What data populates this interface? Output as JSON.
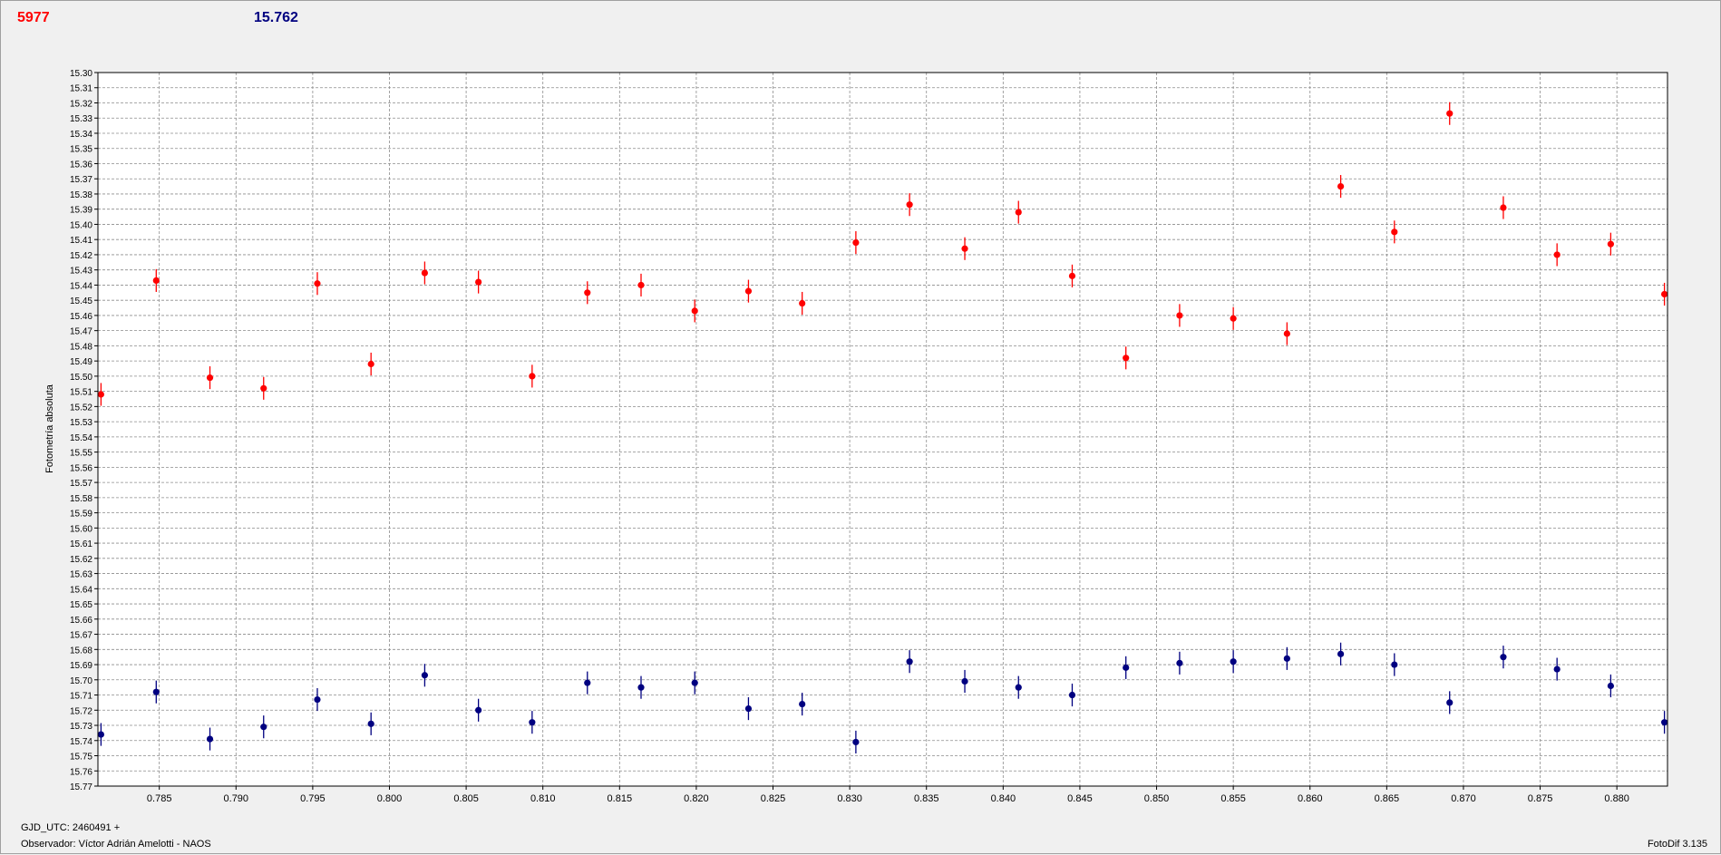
{
  "header": {
    "left_value": "5977",
    "right_value": "15.762",
    "left_color": "#ff0000",
    "right_color": "#000080"
  },
  "footer": {
    "gjd": "GJD_UTC: 2460491 +",
    "observer": "Observador: Víctor Adrián Amelotti - NAOS",
    "software": "FotoDif 3.135"
  },
  "chart_data": {
    "type": "scatter",
    "title": "",
    "xlabel": "",
    "ylabel": "Fotometría absoluta",
    "xlim": [
      0.781,
      0.8833
    ],
    "ylim": [
      15.3,
      15.77
    ],
    "y_inverted": true,
    "grid": true,
    "x_ticks": [
      "0.785",
      "0.790",
      "0.795",
      "0.800",
      "0.805",
      "0.810",
      "0.815",
      "0.820",
      "0.825",
      "0.830",
      "0.835",
      "0.840",
      "0.845",
      "0.850",
      "0.855",
      "0.860",
      "0.865",
      "0.870",
      "0.875",
      "0.880"
    ],
    "y_ticks": [
      "15.30",
      "15.31",
      "15.32",
      "15.33",
      "15.34",
      "15.35",
      "15.36",
      "15.37",
      "15.38",
      "15.39",
      "15.40",
      "15.41",
      "15.42",
      "15.43",
      "15.44",
      "15.45",
      "15.46",
      "15.47",
      "15.48",
      "15.49",
      "15.50",
      "15.51",
      "15.52",
      "15.53",
      "15.54",
      "15.55",
      "15.56",
      "15.57",
      "15.58",
      "15.59",
      "15.60",
      "15.61",
      "15.62",
      "15.63",
      "15.64",
      "15.65",
      "15.66",
      "15.67",
      "15.68",
      "15.69",
      "15.70",
      "15.71",
      "15.72",
      "15.73",
      "15.74",
      "15.75",
      "15.76",
      "15.77"
    ],
    "series": [
      {
        "color": "#ff0000",
        "x": [
          0.7812,
          0.7848,
          0.7883,
          0.7918,
          0.7953,
          0.7988,
          0.8023,
          0.8058,
          0.8093,
          0.8129,
          0.8164,
          0.8199,
          0.8234,
          0.8269,
          0.8304,
          0.8339,
          0.8375,
          0.841,
          0.8445,
          0.848,
          0.8515,
          0.855,
          0.8585,
          0.862,
          0.8655,
          0.8691,
          0.8726,
          0.8761,
          0.8796,
          0.8831
        ],
        "y": [
          15.512,
          15.437,
          15.501,
          15.508,
          15.439,
          15.492,
          15.432,
          15.438,
          15.5,
          15.445,
          15.44,
          15.457,
          15.444,
          15.452,
          15.412,
          15.387,
          15.416,
          15.392,
          15.434,
          15.488,
          15.46,
          15.462,
          15.472,
          15.375,
          15.405,
          15.327,
          15.389,
          15.42,
          15.413,
          15.446
        ],
        "err": 0.0075
      },
      {
        "color": "#000080",
        "x": [
          0.7812,
          0.7848,
          0.7883,
          0.7918,
          0.7953,
          0.7988,
          0.8023,
          0.8058,
          0.8093,
          0.8129,
          0.8164,
          0.8199,
          0.8234,
          0.8269,
          0.8304,
          0.8339,
          0.8375,
          0.841,
          0.8445,
          0.848,
          0.8515,
          0.855,
          0.8585,
          0.862,
          0.8655,
          0.8691,
          0.8726,
          0.8761,
          0.8796,
          0.8831
        ],
        "y": [
          15.736,
          15.708,
          15.739,
          15.731,
          15.713,
          15.729,
          15.697,
          15.72,
          15.728,
          15.702,
          15.705,
          15.702,
          15.719,
          15.716,
          15.741,
          15.688,
          15.701,
          15.705,
          15.71,
          15.692,
          15.689,
          15.688,
          15.686,
          15.683,
          15.69,
          15.715,
          15.685,
          15.693,
          15.704,
          15.728
        ],
        "err": 0.0075
      }
    ]
  }
}
